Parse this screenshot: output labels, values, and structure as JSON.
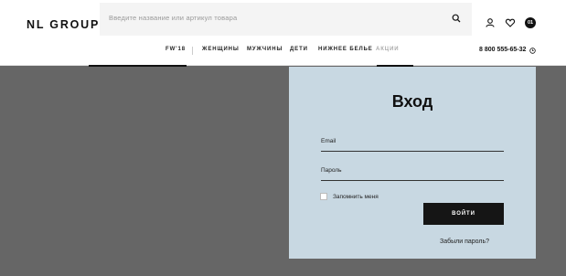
{
  "header": {
    "logo": "NL GROUP",
    "search": {
      "placeholder": "Введите название или артикул товара",
      "icon": "search-icon"
    },
    "icons": [
      "user-icon",
      "heart-icon"
    ],
    "cart_count": "01",
    "phone": "8 800 555-65-32",
    "phone_icon": "clock-icon"
  },
  "nav": {
    "items": [
      {
        "label": "FW'18"
      },
      {
        "label": "ЖЕНЩИНЫ"
      },
      {
        "label": "МУЖЧИНЫ"
      },
      {
        "label": "ДЕТИ"
      },
      {
        "label": "НИЖНЕЕ БЕЛЬЕ"
      },
      {
        "label": "АКЦИИ"
      }
    ]
  },
  "login": {
    "title": "Вход",
    "email_label": "Email",
    "password_label": "Пароль",
    "remember_label": "Запомнить меня",
    "remember_checked": false,
    "submit_label": "ВОЙТИ",
    "forgot_label": "Забыли пароль?"
  },
  "colors": {
    "overlay": "#666666",
    "panel": "#c8d8e2",
    "button": "#151515"
  }
}
